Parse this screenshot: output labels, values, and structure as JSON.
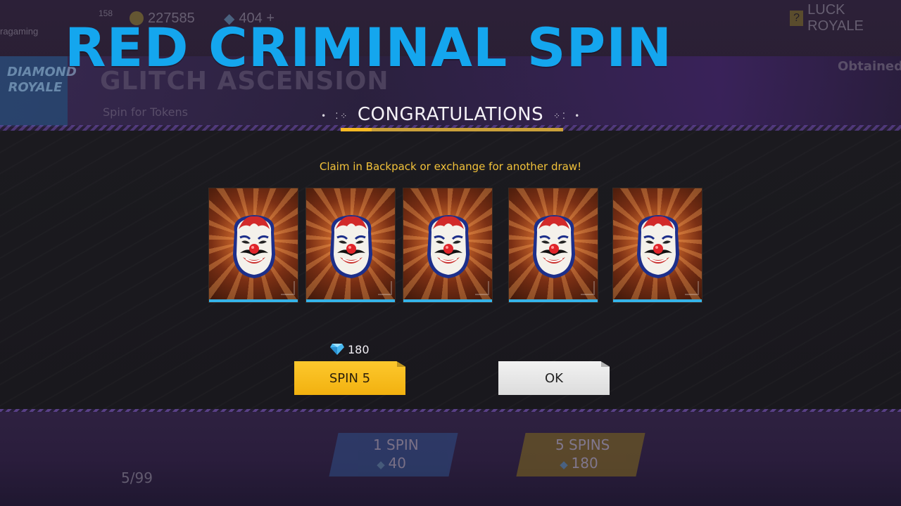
{
  "headline": "RED CRIMINAL SPIN",
  "background": {
    "topbar": {
      "coins": "227585",
      "diamonds": "404 +",
      "mode": "LUCK ROYALE",
      "level": "158",
      "username": "ragaming"
    },
    "side_logo": "DIAMOND ROYALE",
    "event_title": "GLITCH ASCENSION",
    "event_subtitle": "Spin for Tokens",
    "obtained_label": "Obtained",
    "bottom": {
      "progress": "5/99",
      "one_spin_label": "1 SPIN",
      "one_spin_cost": "40",
      "five_spins_label": "5 SPINS",
      "five_spins_cost": "180"
    }
  },
  "dialog": {
    "title": "CONGRATULATIONS",
    "message": "Claim in Backpack or exchange for another draw!",
    "rewards": [
      {
        "name": "Red Criminal Mask"
      },
      {
        "name": "Red Criminal Mask"
      },
      {
        "name": "Red Criminal Mask"
      },
      {
        "name": "Red Criminal Mask"
      },
      {
        "name": "Red Criminal Mask"
      }
    ],
    "spin_cost": "180",
    "spin_button": "SPIN 5",
    "ok_button": "OK"
  },
  "colors": {
    "headline": "#14a6ee",
    "accent_yellow": "#f7b924",
    "message": "#f2c23a",
    "card_bar": "#36b3e8"
  },
  "icons": {
    "currency": "diamond-icon",
    "reward": "clown-mask-icon"
  }
}
